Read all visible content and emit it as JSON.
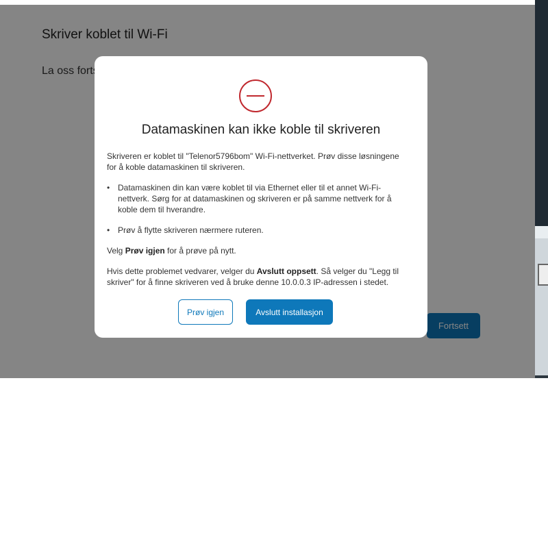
{
  "page": {
    "title": "Skriver koblet til Wi-Fi",
    "subtitle": "La oss fortsette",
    "continue_label": "Fortsett"
  },
  "dialog": {
    "icon": "error-minus-circle-icon",
    "title": "Datamaskinen kan ikke koble til skriveren",
    "intro": "Skriveren er koblet til \"Telenor5796bom\" Wi-Fi-nettverket. Prøv disse løsningene for å koble datamaskinen til skriveren.",
    "bullets": [
      "Datamaskinen din kan være koblet til via Ethernet eller til et annet Wi-Fi-nettverk. Sørg for at datamaskinen og skriveren er på samme nettverk for å koble dem til hverandre.",
      "Prøv å flytte skriveren nærmere ruteren."
    ],
    "retry_line": {
      "prefix": "Velg ",
      "bold": "Prøv igjen",
      "suffix": " for å prøve på nytt."
    },
    "exit_line": {
      "prefix": "Hvis dette problemet vedvarer, velger du ",
      "bold": "Avslutt oppsett",
      "suffix": ". Så velger du \"Legg til skriver\" for å finne skriveren ved å bruke denne 10.0.0.3 IP-adressen i stedet."
    },
    "retry_label": "Prøv igjen",
    "exit_label": "Avslutt installasjon"
  },
  "colors": {
    "accent": "#0e78ba",
    "error": "#c0282e",
    "overlay": "rgba(0,0,0,0.48)"
  }
}
